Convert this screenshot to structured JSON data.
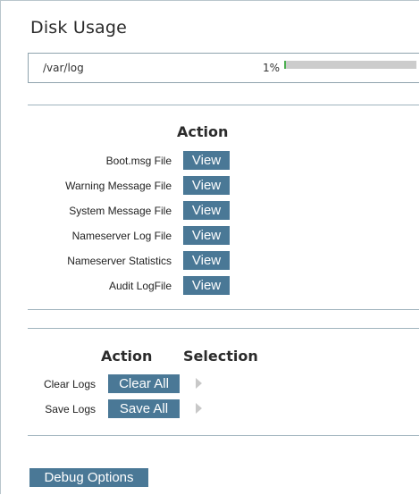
{
  "disk_usage": {
    "title": "Disk Usage",
    "rows": [
      {
        "path": "/var/log",
        "percent_text": "1%",
        "percent_value": 0.01
      }
    ]
  },
  "logs": {
    "header": "Action",
    "button_label": "View",
    "items": [
      {
        "label": "Boot.msg File"
      },
      {
        "label": "Warning Message File"
      },
      {
        "label": "System Message File"
      },
      {
        "label": "Nameserver Log File"
      },
      {
        "label": "Nameserver Statistics"
      },
      {
        "label": "Audit LogFile"
      }
    ]
  },
  "actions": {
    "header_action": "Action",
    "header_selection": "Selection",
    "rows": [
      {
        "label": "Clear Logs",
        "button": "Clear All"
      },
      {
        "label": "Save Logs",
        "button": "Save All"
      }
    ]
  },
  "debug": {
    "button": "Debug Options"
  },
  "colors": {
    "button_bg": "#4a7896",
    "bar_fill": "#4caf50",
    "bar_track": "#cccccc",
    "divider": "#9fb3bd"
  }
}
